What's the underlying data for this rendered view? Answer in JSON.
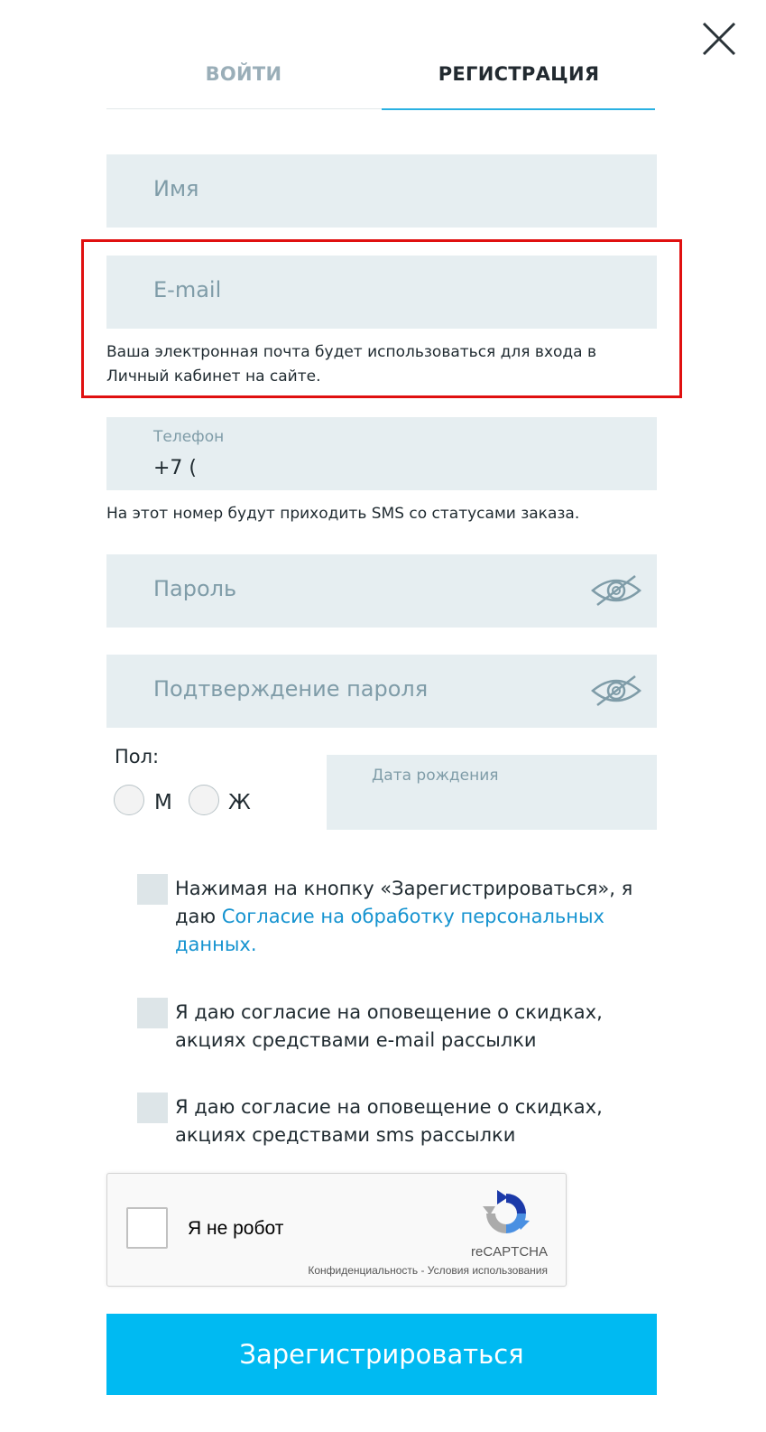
{
  "tabs": {
    "login": "ВОЙТИ",
    "register": "РЕГИСТРАЦИЯ",
    "active": "register"
  },
  "form": {
    "name_placeholder": "Имя",
    "email_placeholder": "E-mail",
    "email_hint": "Ваша электронная почта будет использоваться для входа в Личный кабинет на сайте.",
    "phone_label": "Телефон",
    "phone_value": "+7 (",
    "phone_hint": "На этот номер будут приходить SMS со статусами заказа.",
    "password_placeholder": "Пароль",
    "password_confirm_placeholder": "Подтверждение пароля",
    "gender_label": "Пол:",
    "gender_male": "М",
    "gender_female": "Ж",
    "birthdate_label": "Дата рождения"
  },
  "consents": {
    "personal_data_prefix": "Нажимая на кнопку «Зарегистрироваться», я даю ",
    "personal_data_link": "Согласие на обработку персональных данных.",
    "email_consent": "Я даю согласие на оповещение о скидках, акциях средствами e-mail рассылки",
    "sms_consent": "Я даю согласие на оповещение о скидках, акциях средствами sms рассылки"
  },
  "recaptcha": {
    "label": "Я не робот",
    "brand": "reCAPTCHA",
    "privacy": "Конфиденциальность",
    "separator": " - ",
    "terms": "Условия использования"
  },
  "submit_label": "Зарегистрироваться",
  "colors": {
    "accent": "#00baf2",
    "tab_underline": "#2ab1e2",
    "field_bg": "#e6eef1",
    "link": "#1593d0",
    "highlight_border": "#e01010"
  },
  "icons": {
    "close": "close-icon",
    "password_toggle": "eye-crossed-icon",
    "recaptcha": "recaptcha-logo-icon"
  }
}
